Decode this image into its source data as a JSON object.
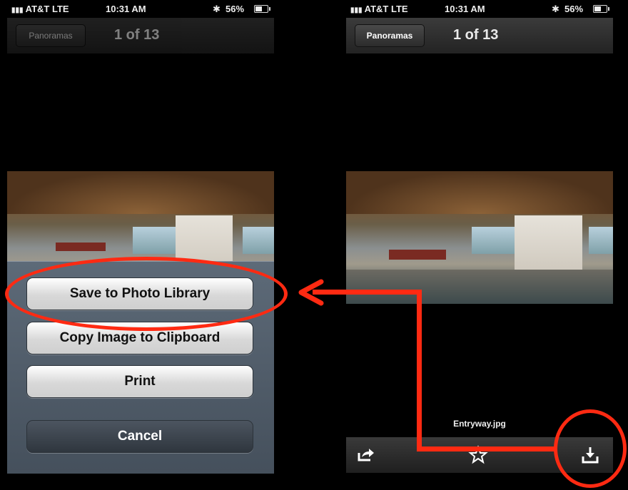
{
  "status": {
    "carrier": "AT&T",
    "network": "LTE",
    "time": "10:31 AM",
    "battery": "56%"
  },
  "navbar": {
    "back_label": "Panoramas",
    "title": "1 of 13"
  },
  "action_sheet": {
    "save": "Save to Photo Library",
    "copy": "Copy Image to Clipboard",
    "print": "Print",
    "cancel": "Cancel"
  },
  "viewer": {
    "filename": "Entryway.jpg"
  },
  "icons": [
    "share-icon",
    "star-icon",
    "download-icon",
    "bluetooth-icon",
    "battery-icon",
    "signal-icon"
  ],
  "colors": {
    "annotation": "#ff2a12"
  }
}
